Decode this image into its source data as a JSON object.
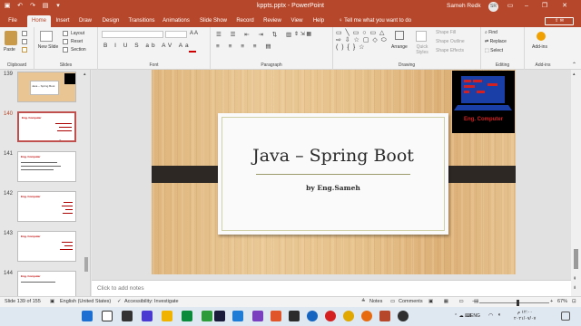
{
  "window": {
    "title": "kppts.pptx  -  PowerPoint",
    "user_name": "Sameh Redk",
    "user_initials": "SR",
    "minimize": "–",
    "restore": "❐",
    "close": "✕"
  },
  "tabs": [
    {
      "label": "File",
      "active": false
    },
    {
      "label": "Home",
      "active": true
    },
    {
      "label": "Insert",
      "active": false
    },
    {
      "label": "Draw",
      "active": false
    },
    {
      "label": "Design",
      "active": false
    },
    {
      "label": "Transitions",
      "active": false
    },
    {
      "label": "Animations",
      "active": false
    },
    {
      "label": "Slide Show",
      "active": false
    },
    {
      "label": "Record",
      "active": false
    },
    {
      "label": "Review",
      "active": false
    },
    {
      "label": "View",
      "active": false
    },
    {
      "label": "Help",
      "active": false
    }
  ],
  "tell_me": "Tell me what you want to do",
  "ribbon": {
    "clipboard": {
      "label": "Clipboard",
      "paste": "Paste"
    },
    "slides": {
      "label": "Slides",
      "new_slide": "New Slide",
      "layout": "Layout",
      "reset": "Reset",
      "section": "Section"
    },
    "font": {
      "label": "Font"
    },
    "paragraph": {
      "label": "Paragraph"
    },
    "drawing": {
      "label": "Drawing",
      "arrange": "Arrange",
      "quick_styles": "Quick Styles",
      "shape_fill": "Shape Fill",
      "shape_outline": "Shape Outline",
      "shape_effects": "Shape Effects"
    },
    "editing": {
      "label": "Editing",
      "find": "Find",
      "replace": "Replace",
      "select": "Select"
    },
    "addins": {
      "label": "Add-ins",
      "button": "Add-ins"
    }
  },
  "thumbnails": [
    {
      "number": "139",
      "selected": false,
      "kind": "title"
    },
    {
      "number": "140",
      "selected": true,
      "kind": "content"
    },
    {
      "number": "141",
      "selected": false,
      "kind": "content"
    },
    {
      "number": "142",
      "selected": false,
      "kind": "content"
    },
    {
      "number": "143",
      "selected": false,
      "kind": "content"
    },
    {
      "number": "144",
      "selected": false,
      "kind": "content"
    }
  ],
  "thumb_text": {
    "title_mini": "Java – Spring Boot",
    "content_mini": "Eng.  Computer"
  },
  "slide": {
    "title": "Java – Spring Boot",
    "subtitle": "by Eng.Sameh",
    "logo_text": "Eng.  Computer"
  },
  "notes_placeholder": "Click to add notes",
  "status": {
    "slide_counter": "Slide 139 of 155",
    "language": "English (United States)",
    "accessibility": "Accessibility: Investigate",
    "notes": "Notes",
    "comments": "Comments",
    "zoom": "67%"
  },
  "taskbar": {
    "language": "ENG",
    "time": "١٢:٠٠ م",
    "date": "٢٠٢١/٠٧/٠٧"
  },
  "colors": {
    "accent": "#b7472a",
    "slide_band": "#2e2824",
    "logo_red": "#d42020"
  }
}
